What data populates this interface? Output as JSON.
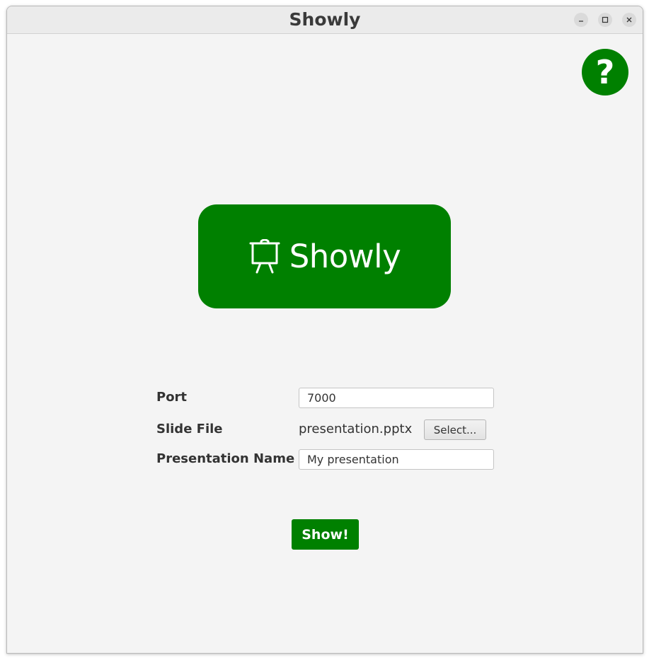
{
  "window": {
    "title": "Showly",
    "controls": {
      "minimize_icon": "minimize-icon",
      "maximize_icon": "maximize-icon",
      "close_icon": "close-icon"
    }
  },
  "help": {
    "label": "?",
    "icon": "help-icon"
  },
  "logo": {
    "text": "Showly",
    "icon": "presentation-easel-icon"
  },
  "form": {
    "port": {
      "label": "Port",
      "value": "7000"
    },
    "slide_file": {
      "label": "Slide File",
      "filename": "presentation.pptx",
      "button_label": "Select..."
    },
    "presentation_name": {
      "label": "Presentation Name",
      "value": "My presentation"
    }
  },
  "actions": {
    "show_label": "Show!"
  },
  "colors": {
    "brand_green": "#008000",
    "window_background": "#f4f4f4",
    "titlebar_background": "#ebebeb",
    "text": "#333333"
  }
}
